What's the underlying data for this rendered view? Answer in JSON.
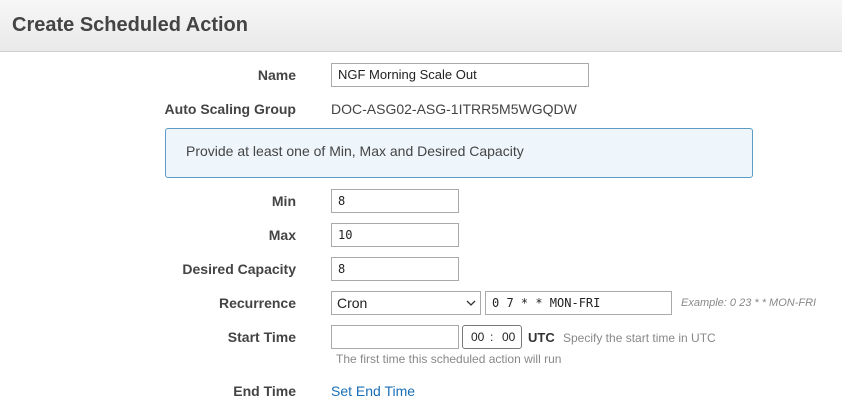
{
  "header": {
    "title": "Create Scheduled Action"
  },
  "form": {
    "name": {
      "label": "Name",
      "value": "NGF Morning Scale Out"
    },
    "asg": {
      "label": "Auto Scaling Group",
      "value": "DOC-ASG02-ASG-1ITRR5M5WGQDW"
    },
    "info": "Provide at least one of Min, Max and Desired Capacity",
    "min": {
      "label": "Min",
      "value": "8"
    },
    "max": {
      "label": "Max",
      "value": "10"
    },
    "desired": {
      "label": "Desired Capacity",
      "value": "8"
    },
    "recurrence": {
      "label": "Recurrence",
      "type": "Cron",
      "expression": "0 7 * * MON-FRI",
      "example": "Example: 0 23 * * MON-FRI"
    },
    "start_time": {
      "label": "Start Time",
      "date": "",
      "hour": "00",
      "separator": ":",
      "minute": "00",
      "tz": "UTC",
      "hint": "Specify the start time in UTC",
      "note": "The first time this scheduled action will run"
    },
    "end_time": {
      "label": "End Time",
      "link": "Set End Time"
    }
  },
  "colors": {
    "info_border": "#5b9bc4",
    "info_bg": "#eef6fb",
    "link": "#1a6eb5"
  }
}
